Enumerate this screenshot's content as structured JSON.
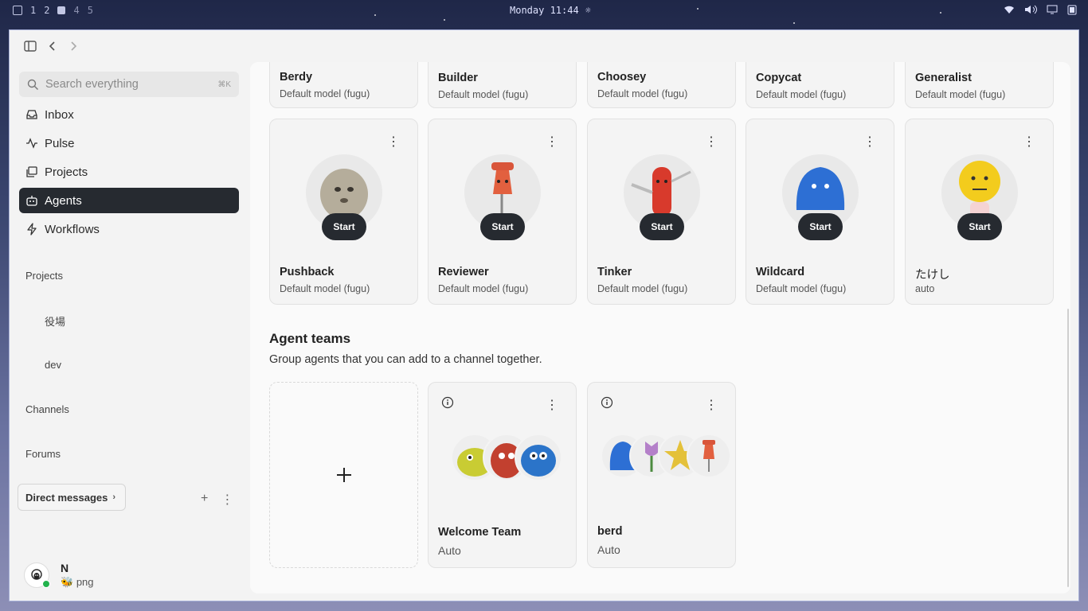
{
  "topbar": {
    "workspaces": [
      "1",
      "2",
      "4",
      "5"
    ],
    "clock": "Monday 11:44"
  },
  "sidebar": {
    "search": {
      "placeholder": "Search everything",
      "shortcut": "⌘K"
    },
    "nav": [
      {
        "label": "Inbox",
        "icon": "inbox-icon"
      },
      {
        "label": "Pulse",
        "icon": "pulse-icon"
      },
      {
        "label": "Projects",
        "icon": "projects-icon"
      },
      {
        "label": "Agents",
        "icon": "bot-icon",
        "active": true
      },
      {
        "label": "Workflows",
        "icon": "bolt-icon"
      }
    ],
    "sections": {
      "projects": "Projects",
      "channels": "Channels",
      "forums": "Forums"
    },
    "project_items": [
      "役場",
      "dev"
    ],
    "direct_messages": "Direct messages",
    "user": {
      "initial": "N",
      "status": "png",
      "status_icon": "🐝"
    }
  },
  "agents_top": [
    {
      "name": "Berdy",
      "model": "Default model (fugu)"
    },
    {
      "name": "Builder",
      "model": "Default model (fugu)"
    },
    {
      "name": "Choosey",
      "model": "Default model (fugu)"
    },
    {
      "name": "Copycat",
      "model": "Default model (fugu)"
    },
    {
      "name": "Generalist",
      "model": "Default model (fugu)"
    }
  ],
  "agents": [
    {
      "name": "Pushback",
      "model": "Default model (fugu)",
      "start": "Start"
    },
    {
      "name": "Reviewer",
      "model": "Default model (fugu)",
      "start": "Start"
    },
    {
      "name": "Tinker",
      "model": "Default model (fugu)",
      "start": "Start"
    },
    {
      "name": "Wildcard",
      "model": "Default model (fugu)",
      "start": "Start"
    },
    {
      "name": "たけし",
      "model": "auto",
      "start": "Start"
    }
  ],
  "teams_section": {
    "title": "Agent teams",
    "subtitle": "Group agents that you can add to a channel together."
  },
  "teams": [
    {
      "name": "Welcome Team",
      "model": "Auto"
    },
    {
      "name": "berd",
      "model": "Auto"
    }
  ]
}
